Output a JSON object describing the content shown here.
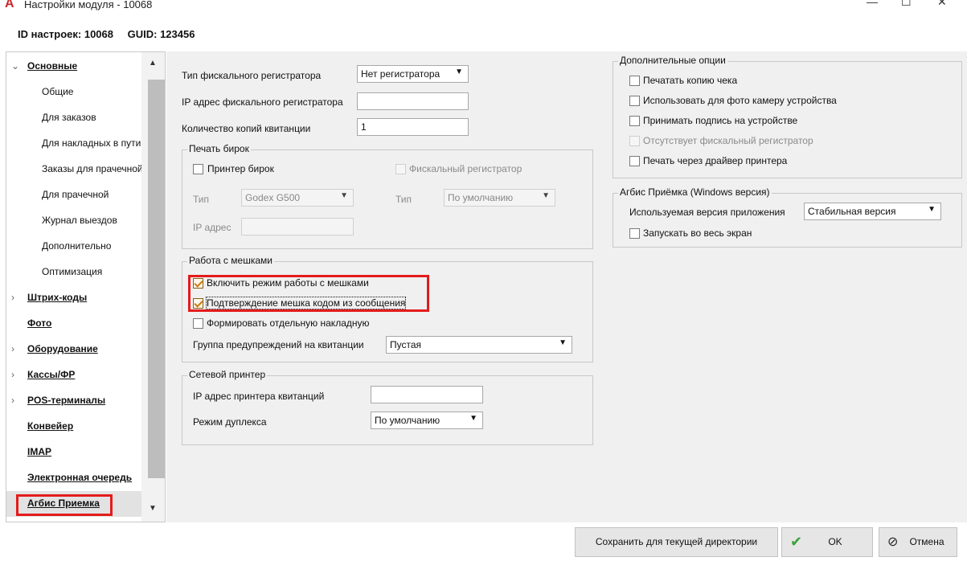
{
  "window": {
    "title": "Настройки модуля   - 10068",
    "min": "—",
    "max": "☐",
    "close": "✕",
    "app_icon": "A"
  },
  "header": {
    "id_text": "ID настроек: 10068",
    "guid_text": "GUID: 123456"
  },
  "sidebar": {
    "items": [
      {
        "label": "Основные"
      },
      {
        "label": "Общие"
      },
      {
        "label": "Для заказов"
      },
      {
        "label": "Для накладных в пути"
      },
      {
        "label": "Заказы для прачечной"
      },
      {
        "label": "Для прачечной"
      },
      {
        "label": "Журнал выездов"
      },
      {
        "label": "Дополнительно"
      },
      {
        "label": "Оптимизация"
      },
      {
        "label": "Штрих-коды"
      },
      {
        "label": "Фото"
      },
      {
        "label": "Оборудование"
      },
      {
        "label": "Кассы/ФР"
      },
      {
        "label": "POS-терминалы"
      },
      {
        "label": "Конвейер"
      },
      {
        "label": "IMAP"
      },
      {
        "label": "Электронная очередь"
      },
      {
        "label": "Агбис Приемка"
      }
    ],
    "chev_expanded": "⌄",
    "chev_collapsed": "›",
    "scroll_up": "▲",
    "scroll_down": "▼"
  },
  "main": {
    "fiscal_type_label": "Тип фискального регистратора",
    "fiscal_type_value": "Нет регистратора",
    "fiscal_ip_label": "IP адрес фискального регистратора",
    "fiscal_ip_value": "",
    "copies_label": "Количество копий квитанции",
    "copies_value": "1",
    "tags": {
      "title": "Печать бирок",
      "tag_printer_label": "Принтер бирок",
      "fiscal_reg_label": "Фискальный регистратор",
      "type1_label": "Тип",
      "type1_value": "Godex G500",
      "type2_label": "Тип",
      "type2_value": "По умолчанию",
      "ip_label": "IP адрес",
      "ip_value": ""
    },
    "bags": {
      "title": "Работа с мешками",
      "enable_label": "Включить режим работы с мешками",
      "confirm_label": "Подтверждение мешка кодом из сообщения",
      "separate_label": "Формировать отдельную накладную",
      "warn_group_label": "Группа предупреждений на квитанции",
      "warn_group_value": "Пустая"
    },
    "netprinter": {
      "title": "Сетевой принтер",
      "ip_label": "IP адрес принтера квитанций",
      "ip_value": "",
      "duplex_label": "Режим дуплекса",
      "duplex_value": "По умолчанию"
    },
    "extra": {
      "title": "Дополнительные опции",
      "opt1": "Печатать копию чека",
      "opt2": "Использовать для фото камеру устройства",
      "opt3": "Принимать подпись на устройстве",
      "opt4": "Отсутствует фискальный регистратор",
      "opt5": "Печать через драйвер принтера"
    },
    "agbis": {
      "title": "Агбис Приёмка (Windows версия)",
      "version_label": "Используемая версия приложения",
      "version_value": "Стабильная версия",
      "fullscreen_label": "Запускать во весь экран"
    },
    "dropdown_arrow": "▼"
  },
  "footer": {
    "save_dir": "Сохранить для текущей директории",
    "ok": "OK",
    "ok_icon": "✔",
    "cancel": "Отмена",
    "cancel_icon": "⊘"
  },
  "colors": {
    "highlight": "#e41b1b",
    "content_bg": "#f0f0f0",
    "ok_check": "#3aa23a"
  }
}
